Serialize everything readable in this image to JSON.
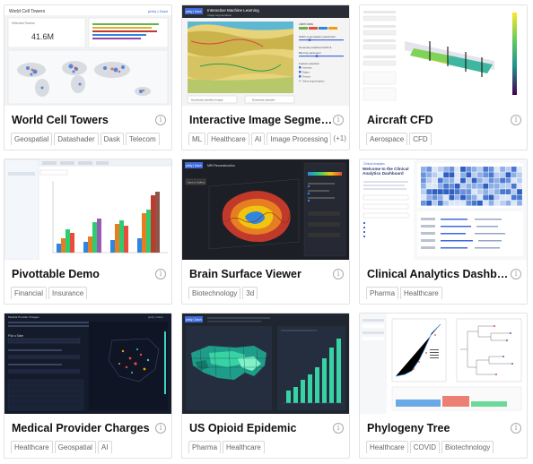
{
  "icons": {
    "info": "i"
  },
  "cards": [
    {
      "title": "World Cell Towers",
      "tags": [
        "Geospatial",
        "Datashader",
        "Dask",
        "Telecom"
      ],
      "extra": "",
      "thumb": {
        "header": "World Cell Towers",
        "brand": "plotly | Dash",
        "stat_label": "Selected Towers",
        "stat_value": "41.6M"
      }
    },
    {
      "title": "Interactive Image Segmenta...",
      "tags": [
        "ML",
        "Healthcare",
        "AI",
        "Image Processing"
      ],
      "extra": "(+1)",
      "thumb": {
        "brand": "plotly | Dash",
        "header": "Interactive Machine Learning",
        "subheader": "Image segmentation",
        "label_class": "Label class",
        "width_label": "Width of annotation paintbrush",
        "prob_label": "Generate predicted width &",
        "blur_label": "Blurring parameter",
        "feature_label": "Feature selection",
        "features": [
          "Intensity",
          "Edges",
          "Texture",
          "Show segmentation"
        ],
        "btn1": "Download classified image",
        "btn2": "Download classifier"
      }
    },
    {
      "title": "Aircraft CFD",
      "tags": [
        "Aerospace",
        "CFD"
      ],
      "extra": "",
      "thumb": {}
    },
    {
      "title": "Pivottable Demo",
      "tags": [
        "Financial",
        "Insurance"
      ],
      "extra": "",
      "thumb": {}
    },
    {
      "title": "Brain Surface Viewer",
      "tags": [
        "Biotechnology",
        "3d"
      ],
      "extra": "",
      "thumb": {
        "brand": "plotly | Dash",
        "header": "MRI Reconstruction",
        "btn": "Save to Gallery"
      }
    },
    {
      "title": "Clinical Analytics Dashboard",
      "tags": [
        "Pharma",
        "Healthcare"
      ],
      "extra": "",
      "thumb": {
        "brand": "Clinical Analytics",
        "welcome": "Welcome to the Clinical Analytics Dashboard"
      }
    },
    {
      "title": "Medical Provider Charges",
      "tags": [
        "Healthcare",
        "Geospatial",
        "AI"
      ],
      "extra": "",
      "thumb": {
        "header": "Medical Provider Charges",
        "brand": "plotly | Dash",
        "state_label": "Pick a State"
      }
    },
    {
      "title": "US Opioid Epidemic",
      "tags": [
        "Pharma",
        "Healthcare"
      ],
      "extra": "",
      "thumb": {
        "brand": "plotly | Dash"
      }
    },
    {
      "title": "Phylogeny Tree",
      "tags": [
        "Healthcare",
        "COVID",
        "Biotechnology"
      ],
      "extra": "",
      "thumb": {}
    }
  ],
  "colors": {
    "dark_bg": "#2b2d36",
    "navy_bg": "#141b2b",
    "teal": "#37d3a4",
    "dash_blue": "#3f6ad8"
  }
}
